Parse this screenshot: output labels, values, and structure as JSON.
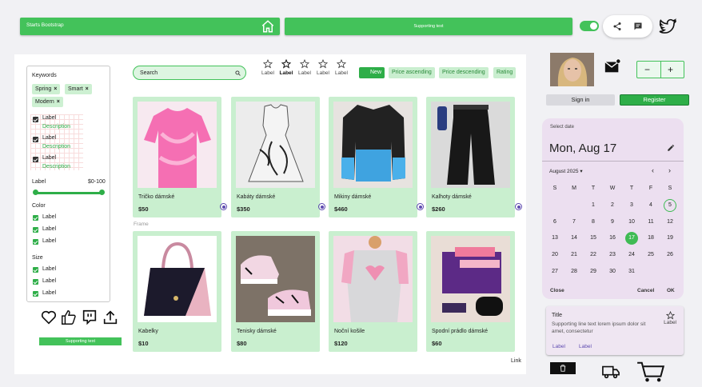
{
  "header": {
    "bar1_label": "Starts Bootstrap",
    "bar2_label": "Supporting text",
    "toggle_on": true
  },
  "sidebar": {
    "keywords_title": "Keywords",
    "chips": [
      "Spring",
      "Smart",
      "Modern"
    ],
    "checklist": [
      {
        "label": "Label",
        "description": "Description"
      },
      {
        "label": "Label",
        "description": "Description"
      },
      {
        "label": "Label",
        "description": "Description"
      }
    ],
    "range": {
      "label": "Label",
      "value": "$0-100",
      "min": 0,
      "max": 100
    },
    "color_title": "Color",
    "color_items": [
      "Label",
      "Label",
      "Label"
    ],
    "size_title": "Size",
    "size_items": [
      "Label",
      "Label",
      "Label"
    ],
    "supporting_text": "Supporting text"
  },
  "toolbar": {
    "search_placeholder": "Search",
    "star_labels": [
      "Label",
      "Label",
      "Label",
      "Label",
      "Label"
    ],
    "filters": [
      "New",
      "Price ascending",
      "Price descending",
      "Rating"
    ]
  },
  "products": [
    {
      "name": "Tričko dámské",
      "price": "$50"
    },
    {
      "name": "Kabáty dámské",
      "price": "$350"
    },
    {
      "name": "Mikiny dámské",
      "price": "$460"
    },
    {
      "name": "Kalhoty dámské",
      "price": "$260"
    },
    {
      "name": "Kabelky",
      "price": "$10"
    },
    {
      "name": "Tenisky dámské",
      "price": "$80"
    },
    {
      "name": "Noční košile",
      "price": "$120"
    },
    {
      "name": "Spodní prádlo dámské",
      "price": "$60"
    }
  ],
  "frame_label": "Frame",
  "link_label": "Link",
  "account": {
    "signin": "Sign in",
    "register": "Register",
    "stepper_minus": "−",
    "stepper_plus": "+"
  },
  "calendar": {
    "select_label": "Select date",
    "selected": "Mon, Aug 17",
    "month": "August 2025",
    "weekdays": [
      "S",
      "M",
      "T",
      "W",
      "T",
      "F",
      "S"
    ],
    "weeks": [
      [
        "",
        "",
        "",
        "",
        "",
        "",
        "5"
      ],
      [
        "6",
        "7",
        "8",
        "9",
        "10",
        "11",
        "12"
      ],
      [
        "13",
        "14",
        "15",
        "16",
        "17",
        "18",
        "19"
      ],
      [
        "20",
        "21",
        "22",
        "23",
        "24",
        "25",
        "26"
      ],
      [
        "27",
        "28",
        "29",
        "30",
        "31",
        "",
        ""
      ]
    ],
    "week0": [
      "",
      "1",
      "2",
      "3",
      "4"
    ],
    "close": "Close",
    "cancel": "Cancel",
    "ok": "OK"
  },
  "info_card": {
    "title": "Title",
    "text": "Supporting line text lorem ipsum dolor sit amet, consectetur",
    "link1": "Label",
    "link2": "Label",
    "star_label": "Label"
  },
  "colors": {
    "accent": "#43c25a",
    "accent_dark": "#2eae48",
    "card_bg": "#c9efcf",
    "calendar_bg": "#ecdff0"
  }
}
